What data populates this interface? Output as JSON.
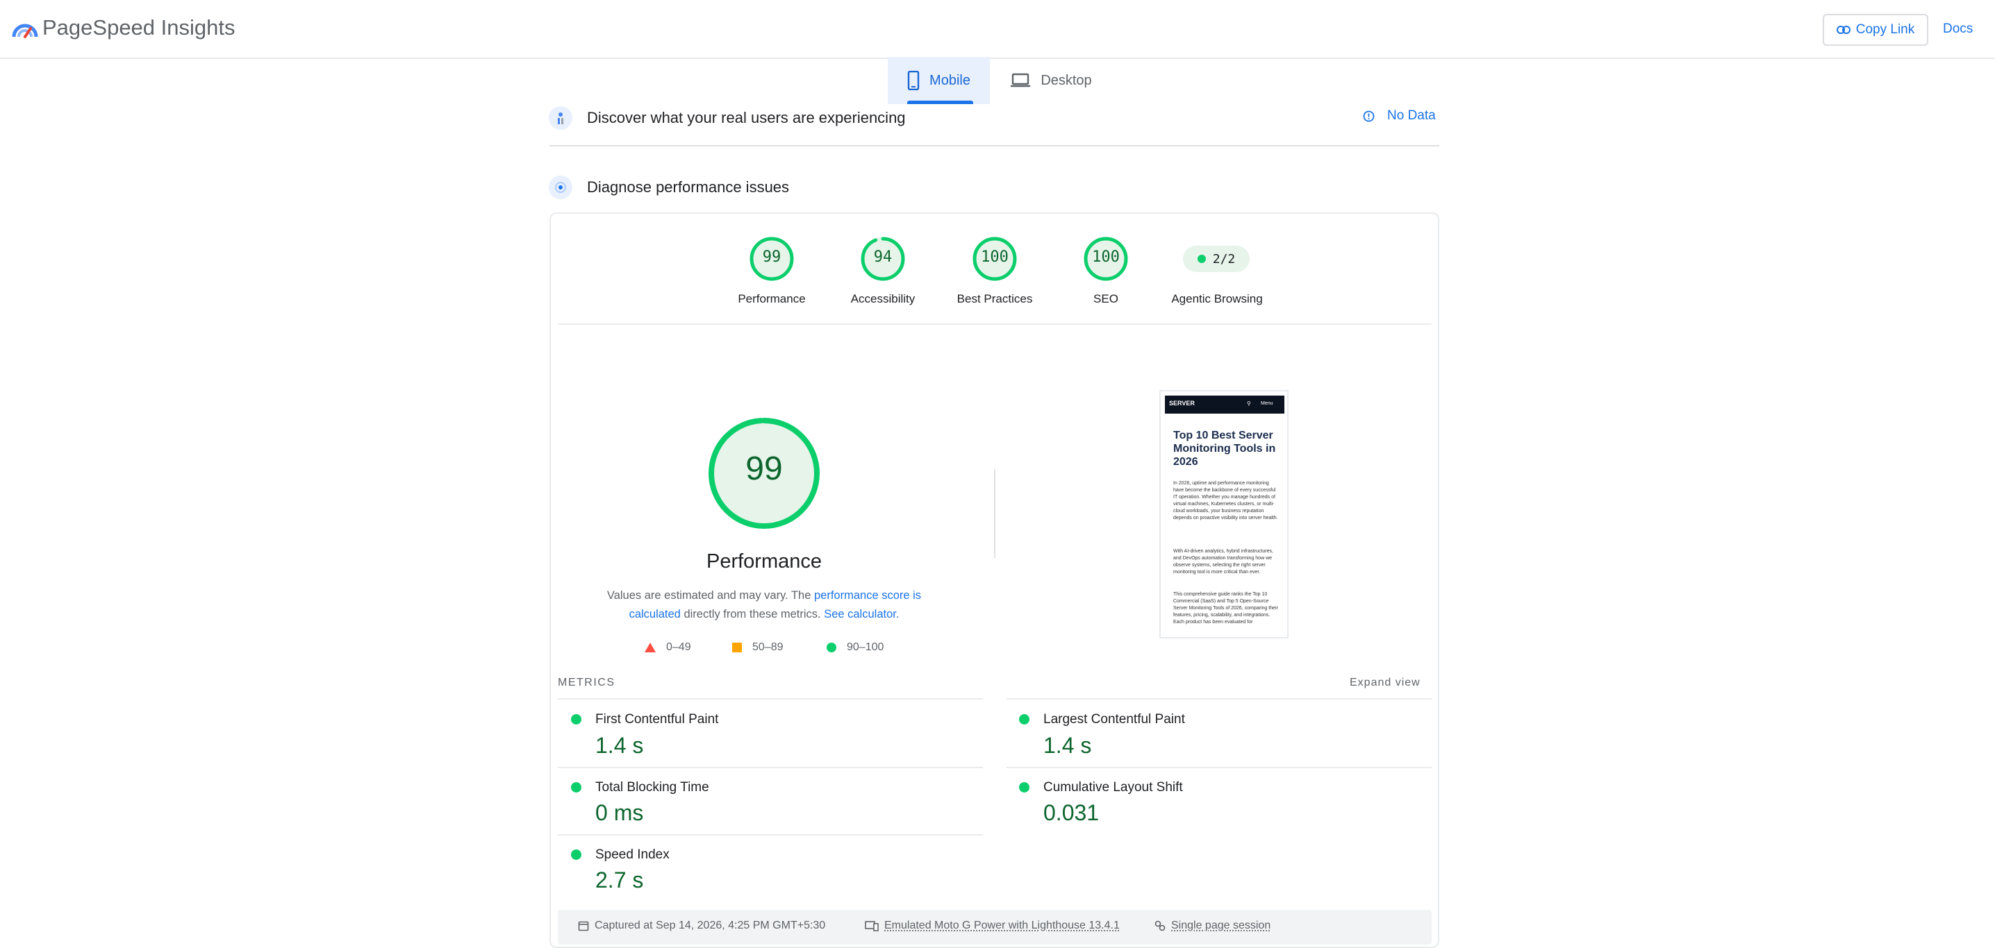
{
  "app": {
    "title": "PageSpeed Insights",
    "copy_link_label": "Copy Link",
    "docs_label": "Docs"
  },
  "tabs": [
    {
      "label": "Mobile",
      "active": true
    },
    {
      "label": "Desktop",
      "active": false
    }
  ],
  "field_data": {
    "title": "Discover what your real users are experiencing",
    "status": "No Data"
  },
  "lab_data": {
    "title": "Diagnose performance issues"
  },
  "scores": [
    {
      "label": "Performance",
      "value": "99",
      "fraction": 0.99
    },
    {
      "label": "Accessibility",
      "value": "94",
      "fraction": 0.94
    },
    {
      "label": "Best Practices",
      "value": "100",
      "fraction": 1.0
    },
    {
      "label": "SEO",
      "value": "100",
      "fraction": 1.0
    }
  ],
  "agentic": {
    "label": "Agentic Browsing",
    "value": "2/2"
  },
  "performance": {
    "score": "99",
    "fraction": 0.99,
    "title": "Performance",
    "desc_prefix": "Values are estimated and may vary. The ",
    "desc_link1": "performance score is calculated",
    "desc_middle": " directly from these metrics. ",
    "desc_link2": "See calculator.",
    "legend": [
      {
        "shape": "triangle",
        "range": "0–49",
        "color": "#ff4e42"
      },
      {
        "shape": "square",
        "range": "50–89",
        "color": "#ffa400"
      },
      {
        "shape": "circle",
        "range": "90–100",
        "color": "#0cce6b"
      }
    ]
  },
  "thumbnail": {
    "logo": "SERVER",
    "menu": "Menu",
    "title": "Top 10 Best Server Monitoring Tools in 2026",
    "para1": "In 2026, uptime and performance monitoring have become the backbone of every successful IT operation. Whether you manage hundreds of virtual machines, Kubernetes clusters, or multi-cloud workloads, your business reputation depends on proactive visibility into server health.",
    "para2": "With AI-driven analytics, hybrid infrastructures, and DevOps automation transforming how we observe systems, selecting the right server monitoring tool is more critical than ever.",
    "para3": "This comprehensive guide ranks the Top 10 Commercial (SaaS) and Top 5 Open-Source Server Monitoring Tools of 2026, comparing their features, pricing, scalability, and integrations. Each product has been evaluated for"
  },
  "metrics": {
    "heading": "METRICS",
    "expand_label": "Expand view",
    "items": [
      {
        "name": "First Contentful Paint",
        "value": "1.4 s"
      },
      {
        "name": "Largest Contentful Paint",
        "value": "1.4 s"
      },
      {
        "name": "Total Blocking Time",
        "value": "0 ms"
      },
      {
        "name": "Cumulative Layout Shift",
        "value": "0.031"
      },
      {
        "name": "Speed Index",
        "value": "2.7 s"
      }
    ]
  },
  "footer": {
    "captured": "Captured at Sep 14, 2026, 4:25 PM GMT+5:30",
    "device": "Emulated Moto G Power with Lighthouse 13.4.1",
    "session": "Single page session"
  },
  "colors": {
    "pass": "#0cce6b",
    "pass_text": "#0d652d",
    "pass_bg": "#e6f4ea",
    "accent": "#1a73e8"
  }
}
